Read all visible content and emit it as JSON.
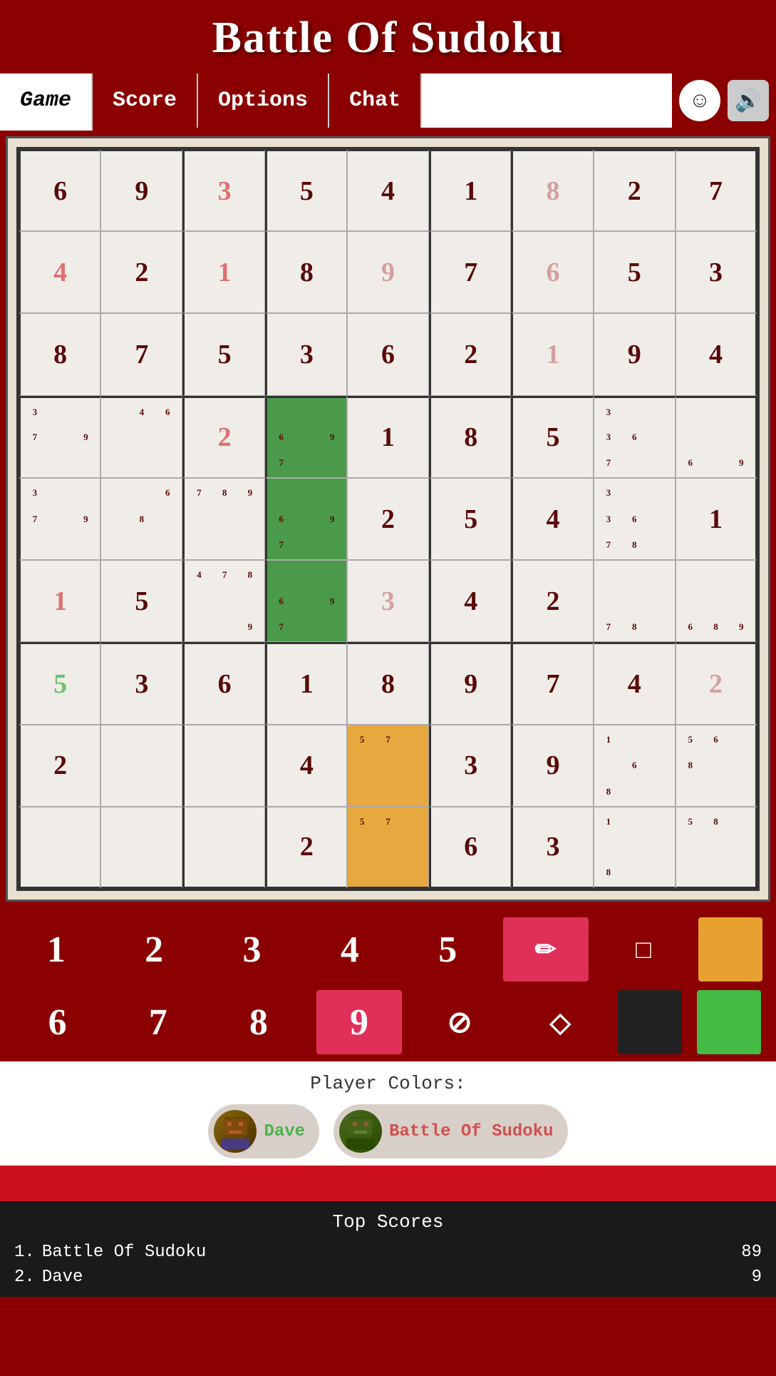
{
  "app": {
    "title": "Battle Of Sudoku"
  },
  "nav": {
    "tabs": [
      {
        "id": "game",
        "label": "Game",
        "active": true
      },
      {
        "id": "score",
        "label": "Score",
        "active": false
      },
      {
        "id": "options",
        "label": "Options",
        "active": false
      },
      {
        "id": "chat",
        "label": "Chat",
        "active": false
      }
    ],
    "emoji_icon": "☺",
    "sound_icon": "🔊"
  },
  "sudoku": {
    "grid": [
      [
        {
          "val": "6",
          "type": "normal"
        },
        {
          "val": "9",
          "type": "normal"
        },
        {
          "val": "3",
          "type": "pink"
        },
        {
          "val": "5",
          "type": "normal"
        },
        {
          "val": "4",
          "type": "normal"
        },
        {
          "val": "1",
          "type": "normal"
        },
        {
          "val": "8",
          "type": "light-pink"
        },
        {
          "val": "2",
          "type": "normal"
        },
        {
          "val": "7",
          "type": "normal"
        }
      ],
      [
        {
          "val": "4",
          "type": "pink"
        },
        {
          "val": "2",
          "type": "normal"
        },
        {
          "val": "1",
          "type": "pink"
        },
        {
          "val": "8",
          "type": "normal"
        },
        {
          "val": "9",
          "type": "light-pink"
        },
        {
          "val": "7",
          "type": "normal"
        },
        {
          "val": "6",
          "type": "light-pink"
        },
        {
          "val": "5",
          "type": "normal"
        },
        {
          "val": "3",
          "type": "normal"
        }
      ],
      [
        {
          "val": "8",
          "type": "normal"
        },
        {
          "val": "7",
          "type": "normal"
        },
        {
          "val": "5",
          "type": "normal"
        },
        {
          "val": "3",
          "type": "normal"
        },
        {
          "val": "6",
          "type": "normal"
        },
        {
          "val": "2",
          "type": "normal"
        },
        {
          "val": "1",
          "type": "light-pink"
        },
        {
          "val": "9",
          "type": "normal"
        },
        {
          "val": "4",
          "type": "normal"
        }
      ],
      [
        {
          "val": "",
          "type": "notes",
          "notes": [
            "3",
            "",
            "",
            "7",
            "",
            "9",
            "",
            "",
            ""
          ]
        },
        {
          "val": "",
          "type": "notes",
          "notes": [
            "",
            "4",
            "6",
            "",
            "",
            "",
            "",
            "",
            ""
          ]
        },
        {
          "val": "2",
          "type": "pink"
        },
        {
          "val": "",
          "type": "green-notes",
          "notes": [
            "",
            "",
            "",
            "6",
            "",
            "9",
            "7",
            "",
            ""
          ]
        },
        {
          "val": "1",
          "type": "normal"
        },
        {
          "val": "8",
          "type": "normal"
        },
        {
          "val": "5",
          "type": "normal"
        },
        {
          "val": "",
          "type": "notes",
          "notes": [
            "3",
            "",
            "",
            "3",
            "6",
            "",
            "7",
            "",
            ""
          ]
        },
        {
          "val": "",
          "type": "notes",
          "notes": [
            "",
            "",
            "",
            "",
            "",
            "",
            "6",
            "",
            "9"
          ]
        }
      ],
      [
        {
          "val": "",
          "type": "notes",
          "notes": [
            "3",
            "",
            "",
            "7",
            "",
            "9",
            "",
            "",
            ""
          ]
        },
        {
          "val": "",
          "type": "notes",
          "notes": [
            "",
            "",
            "6",
            "",
            "8",
            "",
            "",
            "",
            ""
          ]
        },
        {
          "val": "",
          "type": "notes",
          "notes": [
            "7",
            "8",
            "9",
            "",
            "",
            "",
            "",
            "",
            ""
          ]
        },
        {
          "val": "",
          "type": "green-notes",
          "notes": [
            "",
            "",
            "",
            "6",
            "",
            "9",
            "7",
            "",
            ""
          ]
        },
        {
          "val": "2",
          "type": "normal"
        },
        {
          "val": "5",
          "type": "normal"
        },
        {
          "val": "4",
          "type": "normal"
        },
        {
          "val": "",
          "type": "notes",
          "notes": [
            "3",
            "",
            "",
            "3",
            "6",
            "",
            "7",
            "8",
            ""
          ]
        },
        {
          "val": "1",
          "type": "normal"
        }
      ],
      [
        {
          "val": "1",
          "type": "pink"
        },
        {
          "val": "5",
          "type": "normal"
        },
        {
          "val": "",
          "type": "notes",
          "notes": [
            "4",
            "7",
            "8",
            "",
            "",
            "",
            "",
            "",
            "9"
          ]
        },
        {
          "val": "",
          "type": "green-notes",
          "notes": [
            "",
            "",
            "",
            "6",
            "",
            "9",
            "7",
            "",
            ""
          ]
        },
        {
          "val": "3",
          "type": "light-pink"
        },
        {
          "val": "4",
          "type": "normal"
        },
        {
          "val": "2",
          "type": "normal"
        },
        {
          "val": "",
          "type": "notes",
          "notes": [
            "",
            "",
            "",
            "",
            "",
            "",
            "7",
            "8",
            ""
          ]
        },
        {
          "val": "",
          "type": "notes",
          "notes": [
            "",
            "",
            "",
            "",
            "",
            "",
            "6",
            "8",
            "9"
          ]
        }
      ],
      [
        {
          "val": "5",
          "type": "light-green"
        },
        {
          "val": "3",
          "type": "normal"
        },
        {
          "val": "6",
          "type": "normal"
        },
        {
          "val": "1",
          "type": "normal"
        },
        {
          "val": "8",
          "type": "normal"
        },
        {
          "val": "9",
          "type": "normal"
        },
        {
          "val": "7",
          "type": "normal"
        },
        {
          "val": "4",
          "type": "normal"
        },
        {
          "val": "2",
          "type": "light-pink"
        }
      ],
      [
        {
          "val": "2",
          "type": "normal"
        },
        {
          "val": "",
          "type": "empty"
        },
        {
          "val": "",
          "type": "empty"
        },
        {
          "val": "4",
          "type": "normal"
        },
        {
          "val": "",
          "type": "orange-notes",
          "notes": [
            "5",
            "7",
            "",
            "",
            "",
            "",
            "",
            "",
            ""
          ]
        },
        {
          "val": "3",
          "type": "normal"
        },
        {
          "val": "9",
          "type": "normal"
        },
        {
          "val": "",
          "type": "notes",
          "notes": [
            "1",
            "",
            "",
            "",
            "6",
            "",
            "8",
            "",
            ""
          ]
        },
        {
          "val": "",
          "type": "notes",
          "notes": [
            "5",
            "6",
            "",
            "8",
            "",
            "",
            "",
            "",
            ""
          ]
        }
      ],
      [
        {
          "val": "",
          "type": "empty"
        },
        {
          "val": "",
          "type": "empty"
        },
        {
          "val": "",
          "type": "empty"
        },
        {
          "val": "2",
          "type": "normal"
        },
        {
          "val": "",
          "type": "orange-notes",
          "notes": [
            "5",
            "7",
            "",
            "",
            "",
            "",
            "",
            "",
            ""
          ]
        },
        {
          "val": "6",
          "type": "normal"
        },
        {
          "val": "3",
          "type": "normal"
        },
        {
          "val": "",
          "type": "notes",
          "notes": [
            "1",
            "",
            "",
            "",
            "",
            "",
            "8",
            "",
            ""
          ]
        },
        {
          "val": "",
          "type": "notes",
          "notes": [
            "5",
            "8",
            "",
            "",
            "",
            "",
            "",
            "",
            ""
          ]
        }
      ]
    ]
  },
  "numpad": {
    "row1": [
      {
        "label": "1",
        "highlight": false
      },
      {
        "label": "2",
        "highlight": false
      },
      {
        "label": "3",
        "highlight": false
      },
      {
        "label": "4",
        "highlight": false
      },
      {
        "label": "5",
        "highlight": false
      },
      {
        "label": "✏",
        "highlight": true,
        "tool": true
      },
      {
        "label": "□",
        "highlight": false,
        "tool": true
      },
      {
        "label": "",
        "highlight": false,
        "color": "orange"
      }
    ],
    "row2": [
      {
        "label": "6",
        "highlight": false
      },
      {
        "label": "7",
        "highlight": false
      },
      {
        "label": "8",
        "highlight": false
      },
      {
        "label": "9",
        "highlight": true
      },
      {
        "label": "⊘",
        "highlight": false,
        "tool": true
      },
      {
        "label": "◇",
        "highlight": false,
        "tool": true
      },
      {
        "label": "",
        "highlight": false,
        "color": "black"
      },
      {
        "label": "",
        "highlight": false,
        "color": "green"
      }
    ]
  },
  "player_colors": {
    "label": "Player Colors:",
    "players": [
      {
        "name": "Dave",
        "color": "#50b050",
        "avatar": "🎮"
      },
      {
        "name": "Battle Of Sudoku",
        "color": "#d05050",
        "avatar": "🎮"
      }
    ]
  },
  "top_scores": {
    "title": "Top Scores",
    "scores": [
      {
        "rank": "1.",
        "name": "Battle Of Sudoku",
        "score": "89"
      },
      {
        "rank": "2.",
        "name": "Dave",
        "score": "9"
      }
    ]
  }
}
